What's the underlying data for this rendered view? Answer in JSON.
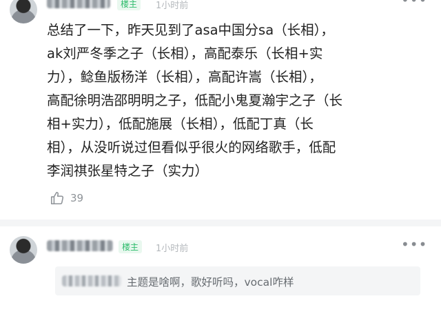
{
  "post": {
    "avatar_icon": "user-avatar",
    "owner_badge": "楼主",
    "timestamp": "1小时前",
    "more_icon": "more-dots-icon",
    "content_lines": [
      "总结了一下，昨天见到了asa中国分sa（长相），",
      "ak刘严冬季之子（长相），高配泰乐（长相+实",
      "力），鲶鱼版杨洋（长相），高配许嵩（长相），",
      "高配徐明浩邵明明之子，低配小鬼夏瀚宇之子（长",
      "相+实力），低配施展（长相），低配丁真（长",
      "相），从没听说过但看似乎很火的网络歌手，低配",
      "李润祺张星特之子（实力）"
    ],
    "like_icon": "thumbs-up-icon",
    "like_count": "39"
  },
  "reply": {
    "avatar_icon": "user-avatar",
    "owner_badge": "楼主",
    "timestamp": "1小时前",
    "more_icon": "more-dots-icon",
    "quote_text": "主题是啥啊，歌好听吗，vocal咋样"
  },
  "colors": {
    "badge_green": "#2dbb6b",
    "badge_bg": "#e9f8ef",
    "muted_gray": "#b4b8bc",
    "divider": "#f4f5f6"
  }
}
